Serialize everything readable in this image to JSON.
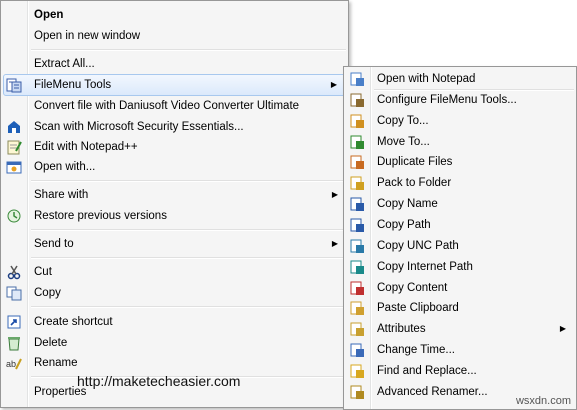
{
  "main_menu": {
    "open": "Open",
    "open_new_window": "Open in new window",
    "extract_all": "Extract All...",
    "filemenu_tools": "FileMenu Tools",
    "convert_file": "Convert file with Daniusoft Video Converter Ultimate",
    "scan": "Scan with Microsoft Security Essentials...",
    "edit_notepad": "Edit with Notepad++",
    "open_with": "Open with...",
    "share_with": "Share with",
    "restore": "Restore previous versions",
    "send_to": "Send to",
    "cut": "Cut",
    "copy": "Copy",
    "create_shortcut": "Create shortcut",
    "delete": "Delete",
    "rename": "Rename",
    "properties": "Properties"
  },
  "submenu": {
    "items": [
      {
        "label": "Open with Notepad",
        "icon": "notepad-icon"
      },
      {
        "label": "Configure FileMenu Tools...",
        "icon": "tools-icon"
      },
      {
        "label": "Copy To...",
        "icon": "copy-to-icon"
      },
      {
        "label": "Move To...",
        "icon": "move-to-icon"
      },
      {
        "label": "Duplicate Files",
        "icon": "duplicate-icon"
      },
      {
        "label": "Pack to Folder",
        "icon": "folder-icon"
      },
      {
        "label": "Copy Name",
        "icon": "copy-name-icon"
      },
      {
        "label": "Copy Path",
        "icon": "copy-path-icon"
      },
      {
        "label": "Copy UNC Path",
        "icon": "unc-path-icon"
      },
      {
        "label": "Copy Internet Path",
        "icon": "internet-path-icon"
      },
      {
        "label": "Copy Content",
        "icon": "copy-content-icon"
      },
      {
        "label": "Paste Clipboard",
        "icon": "clipboard-icon"
      },
      {
        "label": "Attributes",
        "icon": "attributes-icon"
      },
      {
        "label": "Change Time...",
        "icon": "clock-icon"
      },
      {
        "label": "Find and Replace...",
        "icon": "find-replace-icon"
      },
      {
        "label": "Advanced Renamer...",
        "icon": "renamer-icon"
      }
    ]
  },
  "watermark": "http://maketecheasier.com",
  "site_mark": "wsxdn.com"
}
